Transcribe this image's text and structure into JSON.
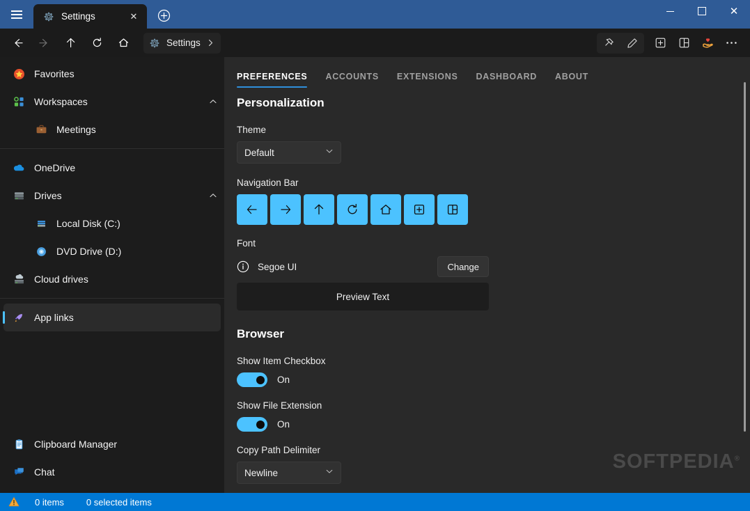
{
  "window": {
    "title": "Settings",
    "menu_icon": "hamburger-icon",
    "minimize_label": "Minimize",
    "maximize_label": "Maximize",
    "close_label": "Close"
  },
  "tabs_strip": {
    "tabs": [
      {
        "label": "Settings",
        "icon": "gear-icon",
        "close_glyph": "✕"
      }
    ],
    "new_tab_glyph": "+"
  },
  "toolbar": {
    "nav": [
      {
        "name": "back",
        "icon": "arrow-left-icon",
        "enabled": true
      },
      {
        "name": "forward",
        "icon": "arrow-right-icon",
        "enabled": false
      },
      {
        "name": "up",
        "icon": "arrow-up-icon",
        "enabled": true
      },
      {
        "name": "refresh",
        "icon": "refresh-icon",
        "enabled": true
      },
      {
        "name": "home",
        "icon": "home-icon",
        "enabled": true
      }
    ],
    "breadcrumb": {
      "label": "Settings",
      "icon": "gear-icon",
      "chevron": "chevron-right-icon"
    },
    "right_icons": [
      {
        "name": "pin",
        "icon": "pin-icon"
      },
      {
        "name": "edit",
        "icon": "pencil-icon"
      },
      {
        "name": "new-tab",
        "icon": "plus-box-icon"
      },
      {
        "name": "split-view",
        "icon": "split-view-icon"
      },
      {
        "name": "donate",
        "icon": "heart-hand-icon"
      },
      {
        "name": "more",
        "icon": "ellipsis-icon"
      }
    ]
  },
  "sidebar": {
    "top_items": [
      {
        "label": "Favorites",
        "icon": "star-icon",
        "child": false,
        "expandable": false,
        "selected": false
      },
      {
        "label": "Workspaces",
        "icon": "workspaces-icon",
        "child": false,
        "expandable": true,
        "selected": false
      },
      {
        "label": "Meetings",
        "icon": "briefcase-icon",
        "child": true,
        "expandable": false,
        "selected": false
      }
    ],
    "mid_items": [
      {
        "label": "OneDrive",
        "icon": "cloud-icon",
        "child": false,
        "expandable": false,
        "selected": false
      },
      {
        "label": "Drives",
        "icon": "drive-icon",
        "child": false,
        "expandable": true,
        "selected": false
      },
      {
        "label": "Local Disk (C:)",
        "icon": "hard-disk-icon",
        "child": true,
        "expandable": false,
        "selected": false
      },
      {
        "label": "DVD Drive (D:)",
        "icon": "dvd-icon",
        "child": true,
        "expandable": false,
        "selected": false
      },
      {
        "label": "Cloud drives",
        "icon": "cloud-drive-icon",
        "child": false,
        "expandable": false,
        "selected": false
      }
    ],
    "selected_items": [
      {
        "label": "App links",
        "icon": "rocket-icon",
        "child": false,
        "expandable": false,
        "selected": true
      }
    ],
    "bottom_items": [
      {
        "label": "Clipboard Manager",
        "icon": "clipboard-icon",
        "child": false,
        "expandable": false,
        "selected": false
      },
      {
        "label": "Chat",
        "icon": "chat-icon",
        "child": false,
        "expandable": false,
        "selected": false
      }
    ]
  },
  "content": {
    "tabs": [
      {
        "label": "PREFERENCES",
        "active": true
      },
      {
        "label": "ACCOUNTS",
        "active": false
      },
      {
        "label": "EXTENSIONS",
        "active": false
      },
      {
        "label": "DASHBOARD",
        "active": false
      },
      {
        "label": "ABOUT",
        "active": false
      }
    ],
    "personalization": {
      "heading": "Personalization",
      "theme_label": "Theme",
      "theme_value": "Default",
      "navbar_label": "Navigation Bar",
      "navbar_buttons": [
        {
          "name": "back",
          "icon": "arrow-left-icon"
        },
        {
          "name": "forward",
          "icon": "arrow-right-icon"
        },
        {
          "name": "up",
          "icon": "arrow-up-icon"
        },
        {
          "name": "refresh",
          "icon": "refresh-icon"
        },
        {
          "name": "home",
          "icon": "home-icon"
        },
        {
          "name": "new-tab",
          "icon": "plus-box-icon"
        },
        {
          "name": "split-view",
          "icon": "split-view-icon"
        }
      ],
      "font_label": "Font",
      "font_name": "Segoe UI",
      "font_change_button": "Change",
      "preview_text": "Preview Text"
    },
    "browser": {
      "heading": "Browser",
      "show_item_checkbox_label": "Show Item Checkbox",
      "show_item_checkbox_value": "On",
      "show_file_extension_label": "Show File Extension",
      "show_file_extension_value": "On",
      "copy_path_delimiter_label": "Copy Path Delimiter",
      "copy_path_delimiter_value": "Newline"
    }
  },
  "watermark": {
    "text": "SOFTPEDIA",
    "mark": "®"
  },
  "statusbar": {
    "icon": "warning-icon",
    "items_count": "0 items",
    "selected_count": "0 selected items"
  },
  "colors": {
    "titlebar": "#2f5b96",
    "accent": "#4cc2ff",
    "tab_underline": "#2f8fdb",
    "statusbar": "#0078d4",
    "sidebar_bg": "#1c1c1c",
    "content_bg": "#292929",
    "toolbar_bg": "#1b1b1b"
  }
}
